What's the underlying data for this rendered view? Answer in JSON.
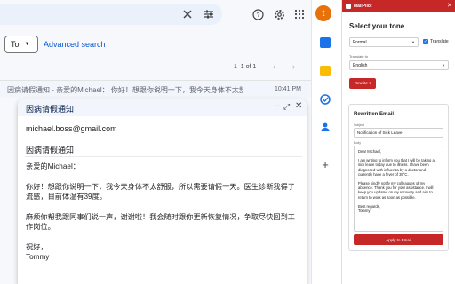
{
  "gmail": {
    "search_strip": "",
    "filter_to_label": "To",
    "advanced_search_label": "Advanced search",
    "pager_text": "1–1 of 1",
    "mail_row": {
      "subject": "因病请假通知 - 亲爱的Michael： 你好！想跟你说明一下，我今天身体不太舒服…",
      "time": "10:41 PM"
    }
  },
  "compose": {
    "title": "因病请假通知",
    "to": "michael.boss@gmail.com",
    "subject": "因病请假通知",
    "body": [
      "亲爱的Michael：",
      "你好！想跟你说明一下，我今天身体不太舒服，所以需要请假一天。医生诊断我得了流感，目前体温有39度。",
      "麻烦你帮我跟同事们说一声，谢谢啦！我会随时跟你更新恢复情况，争取尽快回到工作岗位。",
      "祝好，\nTommy"
    ]
  },
  "avatar_letter": "t",
  "mailpilot": {
    "app_name": "MailPilot",
    "tone_title": "Select your tone",
    "tone_value": "Formal",
    "translate_label": "Translate",
    "translate_checked": true,
    "translate_to_label": "Translate to",
    "language_value": "English",
    "rewrite_label": "Rewrite ▾",
    "card_title": "Rewritten Email",
    "subject_label": "Subject",
    "subject_value": "Notification of Sick Leave",
    "body_label": "Body",
    "body": [
      "Dear Michael,",
      "I am writing to inform you that I will be taking a sick leave today due to illness. I have been diagnosed with influenza by a doctor and currently have a fever of 39°C.",
      "Please kindly notify my colleagues of my absence. Thank you for your assistance. I will keep you updated on my recovery and aim to return to work as soon as possible.",
      "Best regards,\nTommy"
    ],
    "apply_label": "Apply to Email"
  },
  "colors": {
    "accent_red": "#c62828",
    "gmail_blue": "#0b57d0",
    "avatar": "#e8710a"
  }
}
